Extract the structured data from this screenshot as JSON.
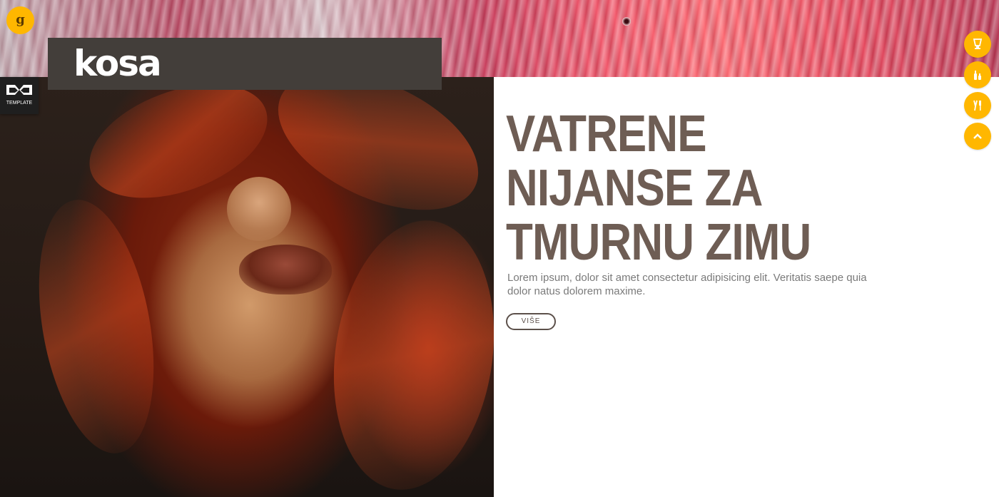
{
  "colors": {
    "accent": "#ffb700",
    "headline": "#6e5d54",
    "header_bar": "#433e3a",
    "body_text": "#7a7a7a"
  },
  "corner_badge": {
    "label": "g"
  },
  "header": {
    "logo": "kosa"
  },
  "template_tab": {
    "label": "TEMPLATE",
    "icon": "m-logo-icon"
  },
  "hero": {
    "headline_lines": [
      "VATRENE",
      "NIJANSE ZA",
      "TMURNU ZIMU"
    ],
    "intro": "Lorem ipsum, dolor sit amet consectetur adipisicing elit. Veritatis saepe quia dolor natus dolorem maxime.",
    "more_label": "VIŠE"
  },
  "side_buttons": [
    {
      "icon": "cup-icon"
    },
    {
      "icon": "bottles-icon"
    },
    {
      "icon": "tools-icon"
    },
    {
      "icon": "chevron-up-icon"
    }
  ]
}
